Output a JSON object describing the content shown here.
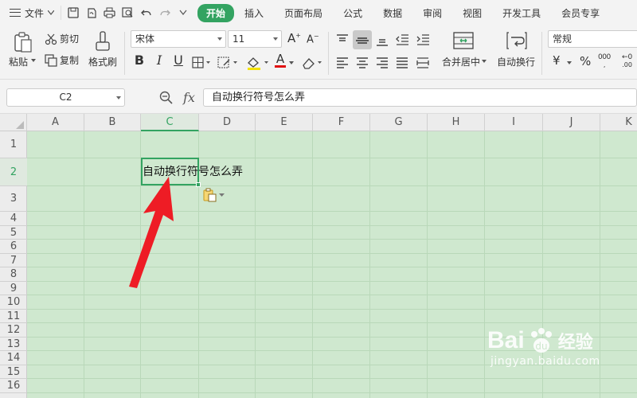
{
  "menu": {
    "file_label": "文件",
    "tabs": [
      {
        "label": "开始",
        "active": true
      },
      {
        "label": "插入"
      },
      {
        "label": "页面布局"
      },
      {
        "label": "公式"
      },
      {
        "label": "数据"
      },
      {
        "label": "审阅"
      },
      {
        "label": "视图"
      },
      {
        "label": "开发工具"
      },
      {
        "label": "会员专享"
      }
    ]
  },
  "ribbon": {
    "paste": "粘贴",
    "cut": "剪切",
    "copy": "复制",
    "format_painter": "格式刷",
    "font_name": "宋体",
    "font_size": "11",
    "bold": "B",
    "italic": "I",
    "underline": "U",
    "font_color_letter": "A",
    "merge_center": "合并居中",
    "wrap_text": "自动换行",
    "number_format": "常规",
    "currency": "¥",
    "percent": "%",
    "thousands": "000"
  },
  "formula_bar": {
    "name_box": "C2",
    "fx": "fx",
    "content": "自动换行符号怎么弄"
  },
  "grid": {
    "columns": [
      "A",
      "B",
      "C",
      "D",
      "E",
      "F",
      "G",
      "H",
      "I",
      "J",
      "K"
    ],
    "rows": [
      "1",
      "2",
      "3",
      "4",
      "5",
      "6",
      "7",
      "8",
      "9",
      "10",
      "11",
      "12",
      "13",
      "14",
      "15",
      "16"
    ],
    "selected_column": "C",
    "selected_row": "2",
    "cell_c2": "自动换行符号怎么弄"
  },
  "watermark": {
    "brand": "Bai",
    "brand_cn": "经验",
    "url": "jingyan.baidu.com"
  },
  "colors": {
    "accent": "#33a361",
    "sheet_bg": "#cfe8cf",
    "arrow": "#ee1c25"
  }
}
